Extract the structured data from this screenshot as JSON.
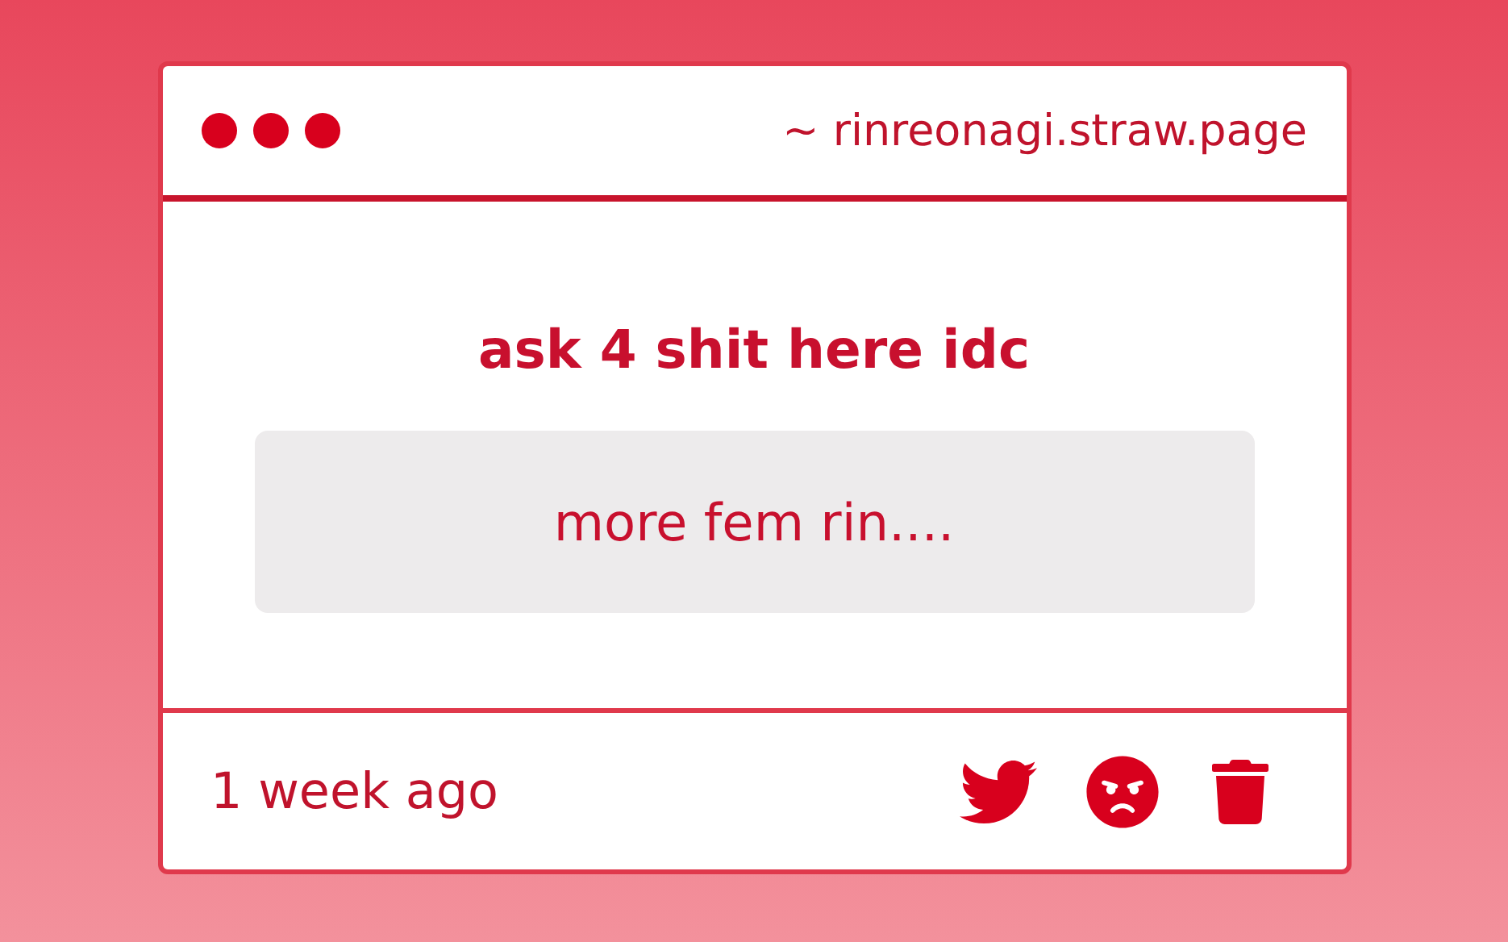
{
  "window": {
    "address": "~ rinreonagi.straw.page"
  },
  "prompt": {
    "title": "ask 4 shit here idc",
    "message": "more fem rin...."
  },
  "footer": {
    "time": "1 week ago"
  }
}
